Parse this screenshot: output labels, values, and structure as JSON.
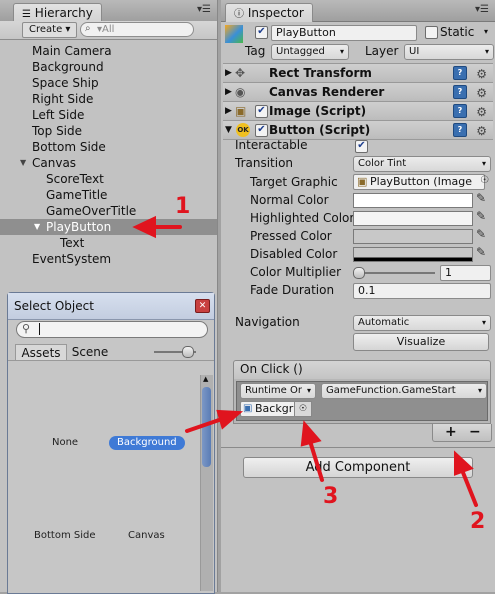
{
  "hierarchy": {
    "tab_label": "Hierarchy",
    "create_label": "Create ▾",
    "search_placeholder": "▾All",
    "items": [
      {
        "label": "Main Camera"
      },
      {
        "label": "Background"
      },
      {
        "label": "Space Ship"
      },
      {
        "label": "Right Side"
      },
      {
        "label": "Left Side"
      },
      {
        "label": "Top Side"
      },
      {
        "label": "Bottom Side"
      },
      {
        "label": "Canvas"
      },
      {
        "label": "ScoreText"
      },
      {
        "label": "GameTitle"
      },
      {
        "label": "GameOverTitle"
      },
      {
        "label": "PlayButton"
      },
      {
        "label": "Text"
      },
      {
        "label": "EventSystem"
      }
    ]
  },
  "inspector": {
    "tab_label": "Inspector",
    "object_name": "PlayButton",
    "static_label": "Static",
    "tag_label": "Tag",
    "tag_value": "Untagged",
    "layer_label": "Layer",
    "layer_value": "UI",
    "components": [
      "Rect Transform",
      "Canvas Renderer",
      "Image (Script)",
      "Button (Script)"
    ],
    "button": {
      "interactable_label": "Interactable",
      "transition_label": "Transition",
      "transition_value": "Color Tint",
      "target_graphic_label": "Target Graphic",
      "target_graphic_value": "PlayButton (Image",
      "normal_color_label": "Normal Color",
      "highlighted_color_label": "Highlighted Color",
      "pressed_color_label": "Pressed Color",
      "disabled_color_label": "Disabled Color",
      "color_multiplier_label": "Color Multiplier",
      "color_multiplier_value": "1",
      "fade_duration_label": "Fade Duration",
      "fade_duration_value": "0.1",
      "navigation_label": "Navigation",
      "navigation_value": "Automatic",
      "visualize_label": "Visualize",
      "on_click_label": "On Click ()",
      "runtime_value": "Runtime Or",
      "function_value": "GameFunction.GameStart",
      "object_value": "Backgr",
      "plus_label": "+",
      "minus_label": "−"
    },
    "add_component_label": "Add Component"
  },
  "select_object": {
    "title": "Select Object",
    "tab_assets": "Assets",
    "tab_scene": "Scene",
    "items": [
      "None",
      "Background",
      "Bottom Side",
      "Canvas"
    ]
  },
  "annotations": {
    "one": "1",
    "two": "2",
    "three": "3",
    "color": "#e0141e"
  }
}
